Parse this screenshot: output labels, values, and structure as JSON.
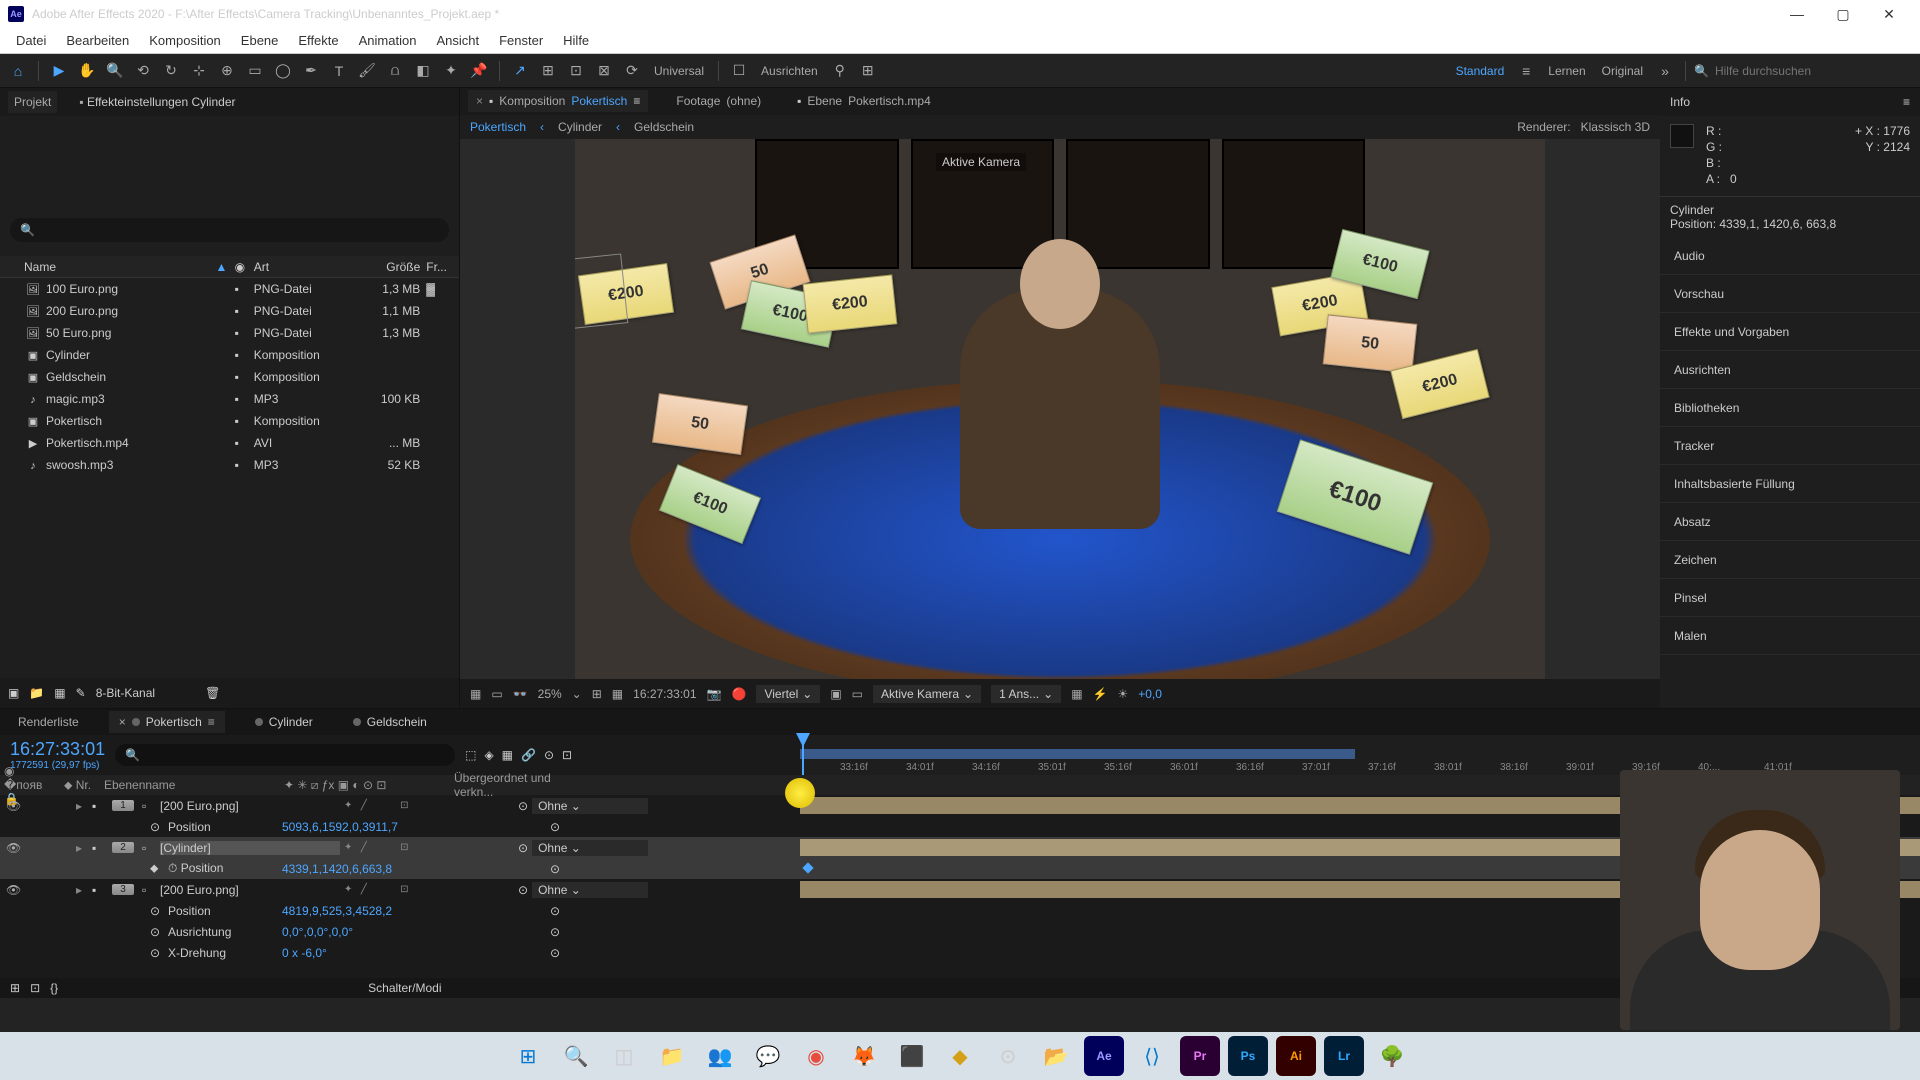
{
  "title": "Adobe After Effects 2020 - F:\\After Effects\\Camera Tracking\\Unbenanntes_Projekt.aep *",
  "menu": [
    "Datei",
    "Bearbeiten",
    "Komposition",
    "Ebene",
    "Effekte",
    "Animation",
    "Ansicht",
    "Fenster",
    "Hilfe"
  ],
  "toolbar": {
    "ausrichten": "Ausrichten",
    "universal": "Universal",
    "workspace_active": "Standard",
    "workspace_learn": "Lernen",
    "workspace_original": "Original",
    "search_placeholder": "Hilfe durchsuchen"
  },
  "project": {
    "tab_project": "Projekt",
    "tab_effects": "Effekteinstellungen Cylinder",
    "cols": {
      "name": "Name",
      "label": "",
      "art": "Art",
      "size": "Größe",
      "fr": "Fr..."
    },
    "rows": [
      {
        "icon": "🖼",
        "name": "100 Euro.png",
        "art": "PNG-Datei",
        "size": "1,3 MB",
        "fr": "▓"
      },
      {
        "icon": "🖼",
        "name": "200 Euro.png",
        "art": "PNG-Datei",
        "size": "1,1 MB",
        "fr": ""
      },
      {
        "icon": "🖼",
        "name": "50 Euro.png",
        "art": "PNG-Datei",
        "size": "1,3 MB",
        "fr": ""
      },
      {
        "icon": "▣",
        "name": "Cylinder",
        "art": "Komposition",
        "size": "",
        "fr": ""
      },
      {
        "icon": "▣",
        "name": "Geldschein",
        "art": "Komposition",
        "size": "",
        "fr": ""
      },
      {
        "icon": "♪",
        "name": "magic.mp3",
        "art": "MP3",
        "size": "100 KB",
        "fr": ""
      },
      {
        "icon": "▣",
        "name": "Pokertisch",
        "art": "Komposition",
        "size": "",
        "fr": ""
      },
      {
        "icon": "▶",
        "name": "Pokertisch.mp4",
        "art": "AVI",
        "size": "... MB",
        "fr": ""
      },
      {
        "icon": "♪",
        "name": "swoosh.mp3",
        "art": "MP3",
        "size": "52 KB",
        "fr": ""
      }
    ],
    "bottom": {
      "bits": "8-Bit-Kanal"
    }
  },
  "comp": {
    "tab_prefix": "Komposition",
    "tab_name": "Pokertisch",
    "footage_prefix": "Footage",
    "footage_name": "(ohne)",
    "layer_prefix": "Ebene",
    "layer_name": "Pokertisch.mp4",
    "bc": [
      "Pokertisch",
      "Cylinder",
      "Geldschein"
    ],
    "renderer_label": "Renderer:",
    "renderer": "Klassisch 3D",
    "camera_label": "Aktive Kamera"
  },
  "viewerbar": {
    "zoom": "25%",
    "tc": "16:27:33:01",
    "quality": "Viertel",
    "camera": "Aktive Kamera",
    "views": "1 Ans...",
    "exposure": "+0,0"
  },
  "info": {
    "title": "Info",
    "r": "R :",
    "g": "G :",
    "b": "B :",
    "a": "A :",
    "aval": "0",
    "x": "X :",
    "xval": "1776",
    "y": "Y :",
    "yval": "2124",
    "sel_name": "Cylinder",
    "sel_pos": "Position: 4339,1, 1420,6, 663,8"
  },
  "panels": [
    "Audio",
    "Vorschau",
    "Effekte und Vorgaben",
    "Ausrichten",
    "Bibliotheken",
    "Tracker",
    "Inhaltsbasierte Füllung",
    "Absatz",
    "Zeichen",
    "Pinsel",
    "Malen"
  ],
  "timeline": {
    "tabs": [
      "Renderliste",
      "Pokertisch",
      "Cylinder",
      "Geldschein"
    ],
    "active_tab": 1,
    "tc": "16:27:33:01",
    "tc2": "1772591 (29,97 fps)",
    "ticks": [
      "33:16f",
      "34:01f",
      "34:16f",
      "35:01f",
      "35:16f",
      "36:01f",
      "36:16f",
      "37:01f",
      "37:16f",
      "38:01f",
      "38:16f",
      "39:01f",
      "39:16f",
      "40:...",
      "41:01f"
    ],
    "col_layer": "Ebenenname",
    "col_parent": "Übergeordnet und verkn...",
    "parent_none": "Ohne",
    "layers": [
      {
        "n": "1",
        "name": "[200 Euro.png]",
        "sel": false
      },
      {
        "n": "2",
        "name": "[Cylinder]",
        "sel": true
      },
      {
        "n": "3",
        "name": "[200 Euro.png]",
        "sel": false
      }
    ],
    "props": {
      "position": "Position",
      "ausrichtung": "Ausrichtung",
      "xdrehung": "X-Drehung",
      "pos1": "5093,6,1592,0,3911,7",
      "pos2": "4339,1,1420,6,663,8",
      "pos3": "4819,9,525,3,4528,2",
      "aus": "0,0°,0,0°,0,0°",
      "xd": "0 x -6,0°"
    },
    "footer": "Schalter/Modi"
  }
}
